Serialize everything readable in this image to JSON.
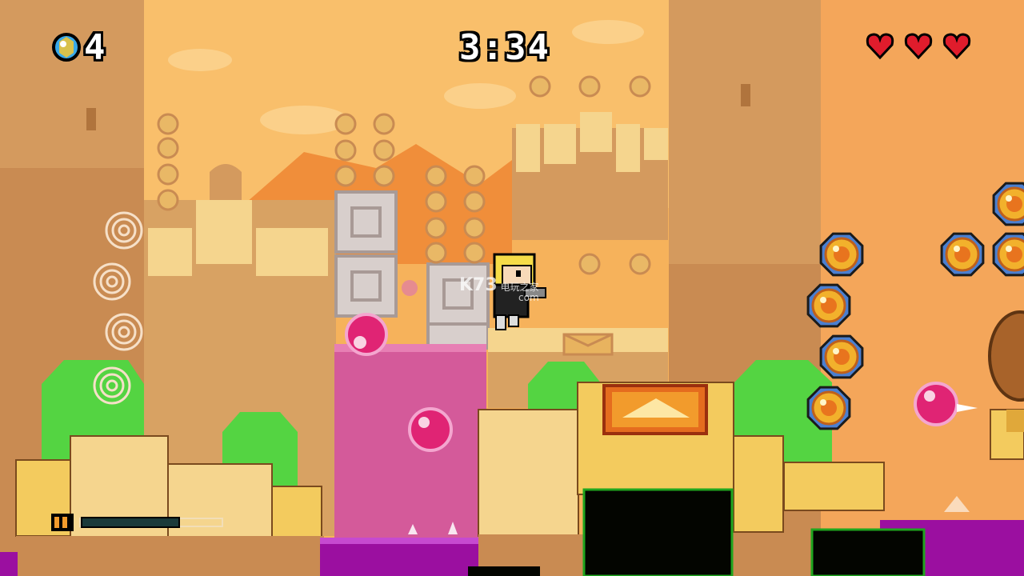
{
  "hud": {
    "gem_icon": "water-sprite-gem-icon",
    "gem_count": "4",
    "timer": "3:34",
    "hearts": {
      "filled": 3,
      "total": 3,
      "color": "#e01c2c"
    },
    "power_bar": {
      "icon": "water-cannon-icon",
      "level": 0.7
    }
  },
  "watermark": {
    "logo": "K73",
    "line1": "电玩之家",
    "line2": "com"
  },
  "colors": {
    "sky": "#f6b25b",
    "coin": "#f2b12c",
    "goo": "#9b0fa0",
    "pink_block": "#d45a9a",
    "green_hill": "#54d442",
    "sand": "#f3cb5e"
  }
}
